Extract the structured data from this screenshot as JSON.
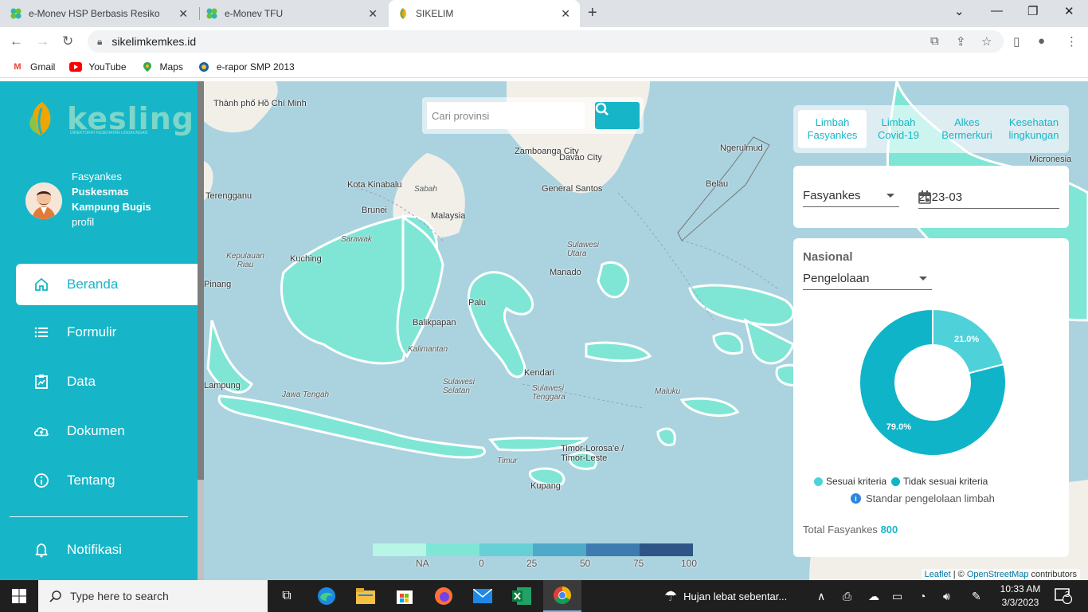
{
  "browser": {
    "tabs": [
      {
        "title": "e-Monev HSP Berbasis Resiko"
      },
      {
        "title": "e-Monev TFU"
      },
      {
        "title": "SIKELIM"
      }
    ],
    "url": "sikelimkemkes.id",
    "bookmarks": [
      {
        "label": "Gmail",
        "icon": "gmail-icon"
      },
      {
        "label": "YouTube",
        "icon": "youtube-icon"
      },
      {
        "label": "Maps",
        "icon": "maps-icon"
      },
      {
        "label": "e-rapor SMP 2013",
        "icon": "erapor-icon"
      }
    ]
  },
  "sidebar": {
    "logo": "kesling",
    "logo_sub": "DIREKTORAT KESEHATAN LINGKUNGAN",
    "profile": {
      "role": "Fasyankes",
      "name": "Puskesmas Kampung Bugis",
      "link": "profil"
    },
    "menu": [
      {
        "label": "Beranda",
        "icon": "home-icon"
      },
      {
        "label": "Formulir",
        "icon": "list-icon"
      },
      {
        "label": "Data",
        "icon": "chart-clipboard-icon"
      },
      {
        "label": "Dokumen",
        "icon": "cloud-upload-icon"
      },
      {
        "label": "Tentang",
        "icon": "info-icon"
      },
      {
        "label": "Notifikasi",
        "icon": "bell-icon"
      }
    ]
  },
  "search": {
    "placeholder": "Cari provinsi"
  },
  "category_tabs": [
    {
      "label": "Limbah Fasyankes",
      "active": true
    },
    {
      "label": "Limbah Covid-19",
      "active": false
    },
    {
      "label": "Alkes Bermerkuri",
      "active": false
    },
    {
      "label": "Kesehatan lingkungan",
      "active": false
    }
  ],
  "filters": {
    "type": "Fasyankes",
    "period": "2023-03"
  },
  "panel": {
    "title": "Nasional",
    "metric": "Pengelolaan",
    "info_text": "Standar pengelolaan limbah",
    "total_label": "Total Fasyankes",
    "total_value": "800"
  },
  "chart_data": {
    "type": "pie",
    "categories": [
      "Sesuai kriteria",
      "Tidak sesuai kriteria"
    ],
    "values": [
      21.0,
      79.0
    ],
    "labels": [
      "21.0%",
      "79.0%"
    ],
    "colors": [
      "#4fd1d9",
      "#0fb4c9"
    ],
    "donut": true,
    "legend_position": "bottom"
  },
  "color_scale": {
    "labels": [
      "NA",
      "0",
      "25",
      "50",
      "75",
      "100"
    ],
    "colors": [
      "#b7f5e6",
      "#7fe6d6",
      "#67cfd6",
      "#4fa9c9",
      "#3e7bb0",
      "#2e5585"
    ]
  },
  "map_labels": [
    "Thành phố Hồ Chí Minh",
    "Zamboanga City",
    "Davao City",
    "General Santos",
    "Ngerulmud",
    "Belau",
    "Micronesia",
    "Kota Kinabalu",
    "Sabah",
    "Brunei",
    "Malaysia",
    "Terengganu",
    "Sarawak",
    "Kuching",
    "Kepulauan Riau",
    "Pinang",
    "Manado",
    "Sulawesi Utara",
    "Palu",
    "Balikpapan",
    "Kalimantan",
    "Maluku",
    "Sulawesi Selatan",
    "Sulawesi Tenggara",
    "Jawa Tengah",
    "Lampung",
    "Timor-Lorosa'e / Timor-Leste",
    "Timur",
    "Kupang",
    "Kendari"
  ],
  "attribution": {
    "leaflet": "Leaflet",
    "sep": " | © ",
    "osm": "OpenStreetMap",
    "tail": " contributors"
  },
  "taskbar": {
    "search_placeholder": "Type here to search",
    "weather": "Hujan lebat sebentar...",
    "time": "10:33 AM",
    "date": "3/3/2023",
    "notif_count": "2"
  }
}
